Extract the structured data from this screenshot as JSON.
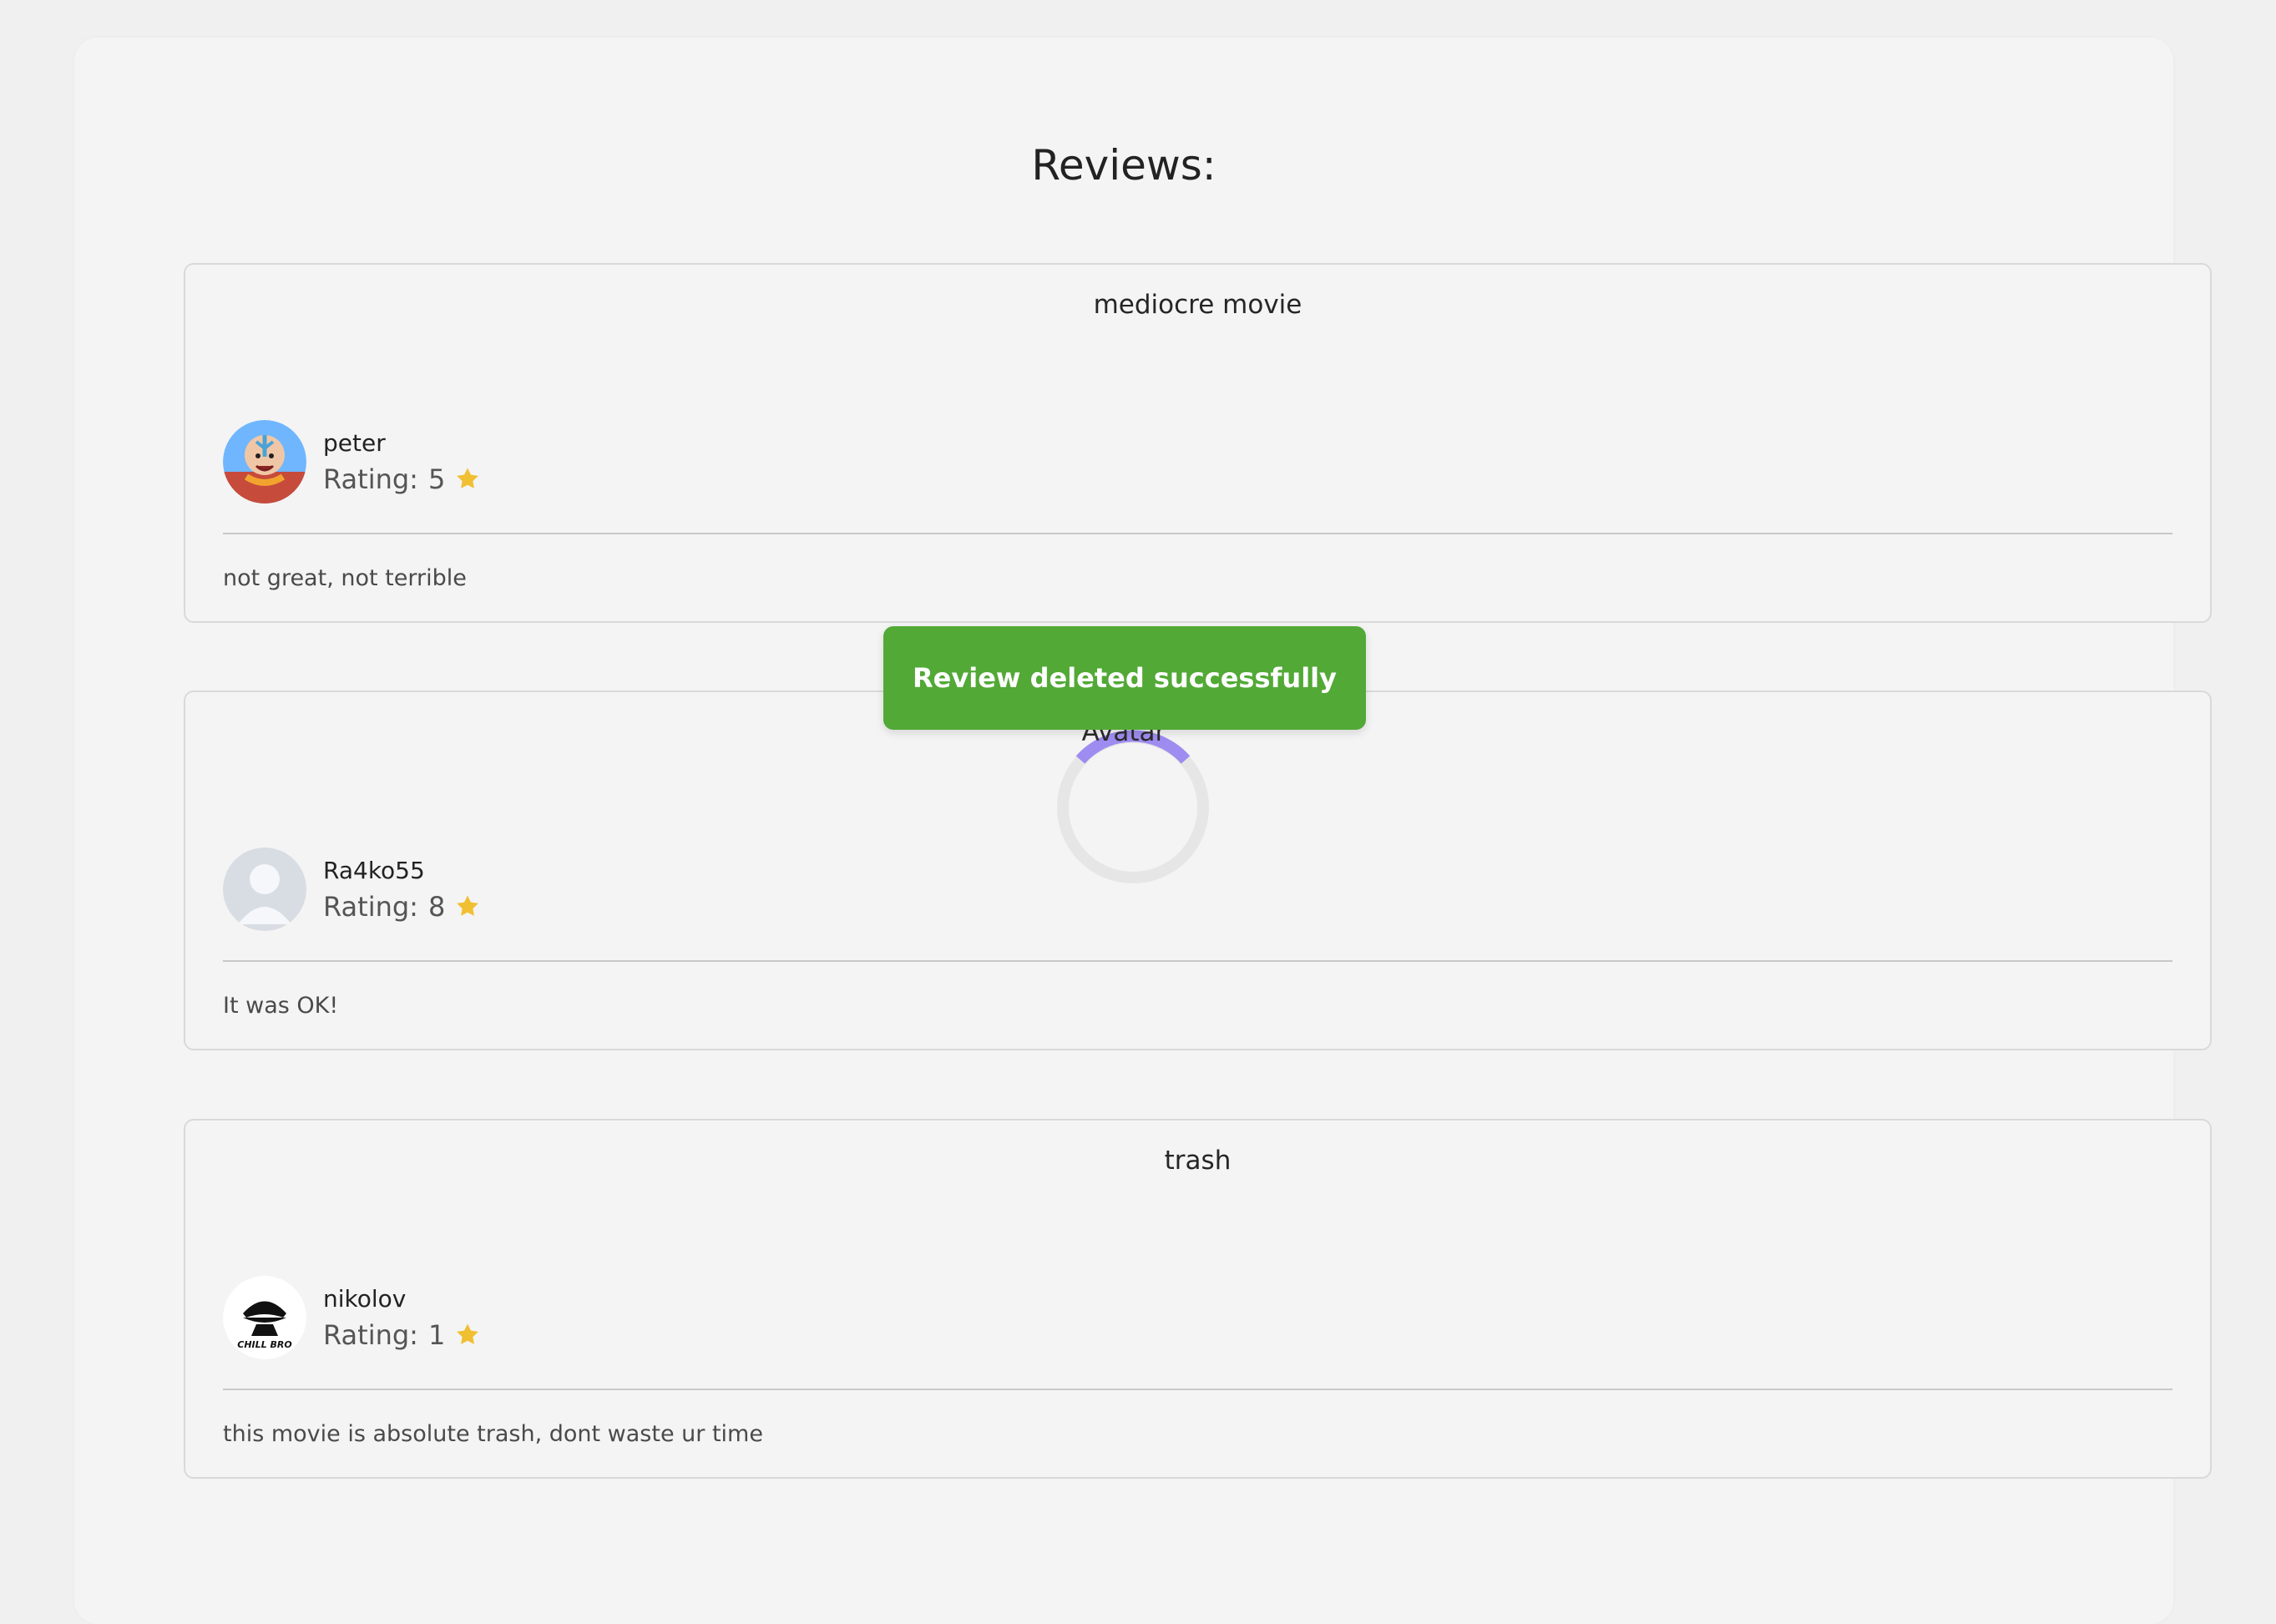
{
  "page": {
    "title": "Reviews:"
  },
  "reviews": [
    {
      "title": "mediocre movie",
      "username": "peter",
      "rating_label": "Rating:",
      "rating_value": "5",
      "text": "not great, not terrible"
    },
    {
      "title": "Avatar",
      "username": "Ra4ko55",
      "rating_label": "Rating:",
      "rating_value": "8",
      "text": "It was OK!"
    },
    {
      "title": "trash",
      "username": "nikolov",
      "rating_label": "Rating:",
      "rating_value": "1",
      "text": "this movie is absolute trash, dont waste ur time"
    }
  ],
  "toast": {
    "message": "Review deleted successfully",
    "color": "#52a936"
  },
  "icons": {
    "star": "star-icon",
    "spinner": "loading-spinner-icon"
  },
  "avatars": {
    "avatar_1": "cartoon-avatar-icon",
    "avatar_2": "default-user-avatar-icon",
    "avatar_3": "chill-bro-avatar-icon",
    "avatar_3_text": "CHILL BRO"
  }
}
